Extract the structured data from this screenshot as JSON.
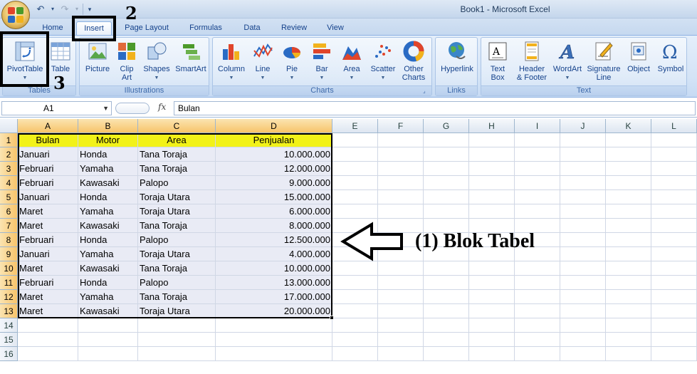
{
  "window": {
    "title": "Book1 - Microsoft Excel"
  },
  "tabs": [
    {
      "label": "Home"
    },
    {
      "label": "Insert"
    },
    {
      "label": "Page Layout"
    },
    {
      "label": "Formulas"
    },
    {
      "label": "Data"
    },
    {
      "label": "Review"
    },
    {
      "label": "View"
    }
  ],
  "ribbon": {
    "groups": {
      "tables": "Tables",
      "illustrations": "Illustrations",
      "charts": "Charts",
      "links": "Links",
      "text": "Text"
    },
    "buttons": {
      "pivottable": "PivotTable",
      "table": "Table",
      "picture": "Picture",
      "clipart": [
        "Clip",
        "Art"
      ],
      "shapes": "Shapes",
      "smartart": "SmartArt",
      "column": "Column",
      "line": "Line",
      "pie": "Pie",
      "bar": "Bar",
      "area": "Area",
      "scatter": "Scatter",
      "other_charts": [
        "Other",
        "Charts"
      ],
      "hyperlink": "Hyperlink",
      "textbox": [
        "Text",
        "Box"
      ],
      "header_footer": [
        "Header",
        "& Footer"
      ],
      "wordart": "WordArt",
      "signature_line": [
        "Signature",
        "Line"
      ],
      "object": "Object",
      "symbol": "Symbol"
    }
  },
  "formula_bar": {
    "name_box": "A1",
    "fx": "fx",
    "value": "Bulan"
  },
  "columns": [
    "A",
    "B",
    "C",
    "D",
    "E",
    "F",
    "G",
    "H",
    "I",
    "J",
    "K",
    "L"
  ],
  "rows": [
    "1",
    "2",
    "3",
    "4",
    "5",
    "6",
    "7",
    "8",
    "9",
    "10",
    "11",
    "12",
    "13",
    "14",
    "15",
    "16"
  ],
  "table": {
    "headers": [
      "Bulan",
      "Motor",
      "Area",
      "Penjualan"
    ],
    "rows": [
      [
        "Januari",
        "Honda",
        "Tana Toraja",
        "10.000.000"
      ],
      [
        "Februari",
        "Yamaha",
        "Tana Toraja",
        "12.000.000"
      ],
      [
        "Februari",
        "Kawasaki",
        "Palopo",
        "9.000.000"
      ],
      [
        "Januari",
        "Honda",
        "Toraja Utara",
        "15.000.000"
      ],
      [
        "Maret",
        "Yamaha",
        "Toraja Utara",
        "6.000.000"
      ],
      [
        "Maret",
        "Kawasaki",
        "Tana Toraja",
        "8.000.000"
      ],
      [
        "Februari",
        "Honda",
        "Palopo",
        "12.500.000"
      ],
      [
        "Januari",
        "Yamaha",
        "Toraja Utara",
        "4.000.000"
      ],
      [
        "Maret",
        "Kawasaki",
        "Tana Toraja",
        "10.000.000"
      ],
      [
        "Februari",
        "Honda",
        "Palopo",
        "13.000.000"
      ],
      [
        "Maret",
        "Yamaha",
        "Tana Toraja",
        "17.000.000"
      ],
      [
        "Maret",
        "Kawasaki",
        "Toraja Utara",
        "20.000.000"
      ]
    ]
  },
  "annotations": {
    "step2": "2",
    "step3": "3",
    "step1_text": "(1) Blok Tabel"
  }
}
